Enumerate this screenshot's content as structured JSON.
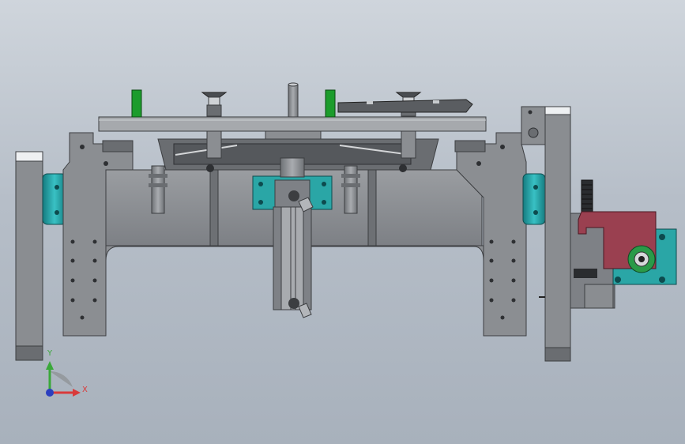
{
  "viewport": {
    "background_top": "#cfd5dc",
    "background_bottom": "#a8b1bc"
  },
  "triad": {
    "x_label": "X",
    "y_label": "Y",
    "x_color": "#d93a3a",
    "y_color": "#3aa83a",
    "z_color": "#2b3fbf"
  },
  "colors": {
    "steel": "#8a8d91",
    "steel_dark": "#5e6166",
    "steel_light": "#b3b6ba",
    "plate": "#a3a6aa",
    "cyan_part": "#2aa6a6",
    "green_marker": "#1c9c2c",
    "motor_bracket": "#9a4050",
    "green_gear": "#2a9a48"
  }
}
